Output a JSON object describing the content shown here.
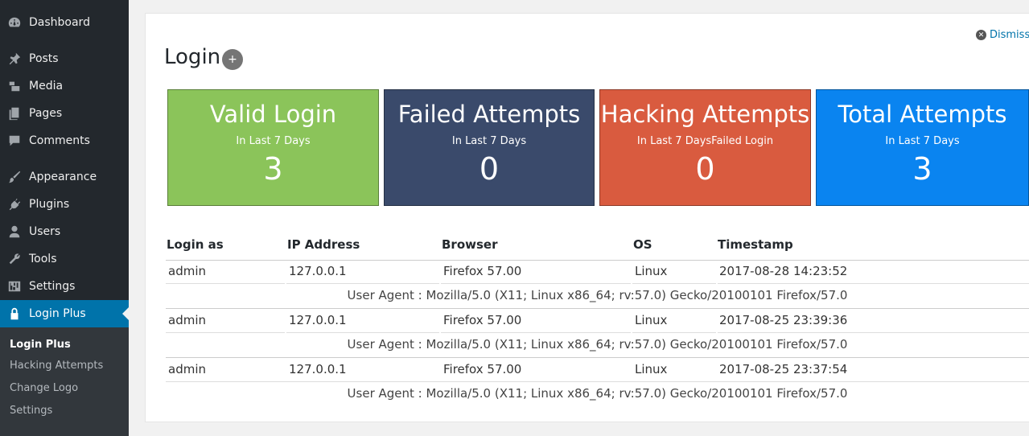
{
  "sidebar": {
    "items": [
      {
        "label": "Dashboard",
        "icon": "dashboard-icon"
      },
      {
        "label": "Posts",
        "icon": "pin-icon"
      },
      {
        "label": "Media",
        "icon": "media-icon"
      },
      {
        "label": "Pages",
        "icon": "pages-icon"
      },
      {
        "label": "Comments",
        "icon": "comment-icon"
      },
      {
        "label": "Appearance",
        "icon": "brush-icon"
      },
      {
        "label": "Plugins",
        "icon": "plugin-icon"
      },
      {
        "label": "Users",
        "icon": "user-icon"
      },
      {
        "label": "Tools",
        "icon": "wrench-icon"
      },
      {
        "label": "Settings",
        "icon": "settings-icon"
      },
      {
        "label": "Login Plus",
        "icon": "lock-icon"
      }
    ],
    "submenu": [
      "Login Plus",
      "Hacking Attempts",
      "Change Logo",
      "Settings"
    ]
  },
  "header": {
    "title": "Login",
    "add_label": "+",
    "dismiss_label": "Dismiss"
  },
  "cards": [
    {
      "title": "Valid Login",
      "subtitle": "In Last 7 Days",
      "value": "3",
      "color": "#8bc45a"
    },
    {
      "title": "Failed Attempts",
      "subtitle": "In Last 7 Days",
      "value": "0",
      "color": "#3a4a6b"
    },
    {
      "title": "Hacking Attempts",
      "subtitle": "In Last 7 DaysFailed Login",
      "value": "0",
      "color": "#d95b3f"
    },
    {
      "title": "Total Attempts",
      "subtitle": "In Last 7 Days",
      "value": "3",
      "color": "#0a84f0"
    }
  ],
  "table": {
    "headers": [
      "Login as",
      "IP Address",
      "Browser",
      "OS",
      "Timestamp"
    ],
    "rows": [
      {
        "login": "admin",
        "ip": "127.0.0.1",
        "browser": "Firefox 57.00",
        "os": "Linux",
        "timestamp": "2017-08-28 14:23:52",
        "user_agent": "User Agent : Mozilla/5.0 (X11; Linux x86_64; rv:57.0) Gecko/20100101 Firefox/57.0"
      },
      {
        "login": "admin",
        "ip": "127.0.0.1",
        "browser": "Firefox 57.00",
        "os": "Linux",
        "timestamp": "2017-08-25 23:39:36",
        "user_agent": "User Agent : Mozilla/5.0 (X11; Linux x86_64; rv:57.0) Gecko/20100101 Firefox/57.0"
      },
      {
        "login": "admin",
        "ip": "127.0.0.1",
        "browser": "Firefox 57.00",
        "os": "Linux",
        "timestamp": "2017-08-25 23:37:54",
        "user_agent": "User Agent : Mozilla/5.0 (X11; Linux x86_64; rv:57.0) Gecko/20100101 Firefox/57.0"
      }
    ]
  }
}
